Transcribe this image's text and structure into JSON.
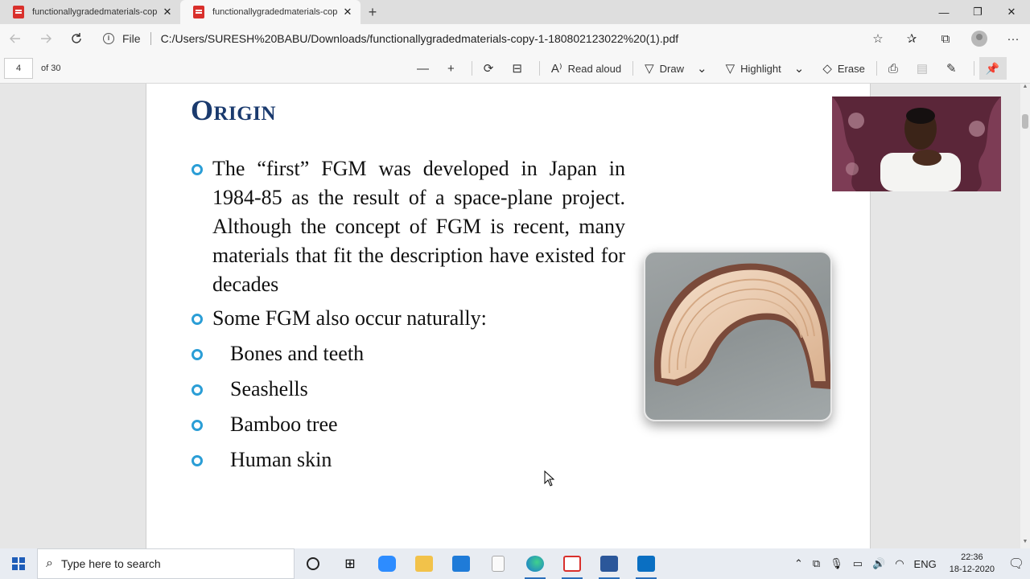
{
  "browser": {
    "tabs": [
      {
        "title": "functionallygradedmaterials-cop",
        "close": "✕",
        "active": false
      },
      {
        "title": "functionallygradedmaterials-cop",
        "close": "✕",
        "active": true
      }
    ],
    "new_tab": "+",
    "window_controls": {
      "minimize": "—",
      "restore": "❐",
      "close": "✕"
    },
    "address": {
      "scheme_label": "File",
      "url": "C:/Users/SURESH%20BABU/Downloads/functionallygradedmaterials-copy-1-180802123022%20(1).pdf"
    }
  },
  "pdf_toolbar": {
    "page_number": "4",
    "page_total": "of 30",
    "read_aloud": "Read aloud",
    "draw": "Draw",
    "highlight": "Highlight",
    "erase": "Erase"
  },
  "slide": {
    "title": "Origin",
    "bullet_1": "The “first” FGM was developed in Japan in 1984-85 as the result of a space-plane project. Although the concept of FGM is recent, many materials that fit the description have existed for decades",
    "bullet_2": "Some FGM also occur naturally:",
    "sub_items": [
      "Bones and teeth",
      "Seashells",
      "Bamboo tree",
      "Human skin"
    ]
  },
  "taskbar": {
    "search_placeholder": "Type here to search",
    "language": "ENG",
    "time": "22:36",
    "date": "18-12-2020"
  },
  "colors": {
    "title": "#1a3a6e",
    "bullet": "#2b9ed6",
    "pdf_icon": "#d9302c"
  }
}
